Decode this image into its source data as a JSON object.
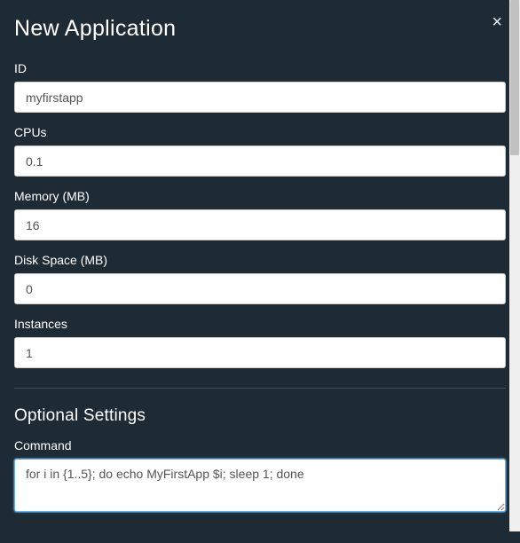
{
  "modal": {
    "title": "New Application"
  },
  "form": {
    "id": {
      "label": "ID",
      "value": "myfirstapp"
    },
    "cpus": {
      "label": "CPUs",
      "value": "0.1"
    },
    "memory": {
      "label": "Memory (MB)",
      "value": "16"
    },
    "disk": {
      "label": "Disk Space (MB)",
      "value": "0"
    },
    "instances": {
      "label": "Instances",
      "value": "1"
    }
  },
  "optional": {
    "title": "Optional Settings",
    "command": {
      "label": "Command",
      "value": "for i in {1..5}; do echo MyFirstApp $i; sleep 1; done"
    }
  }
}
